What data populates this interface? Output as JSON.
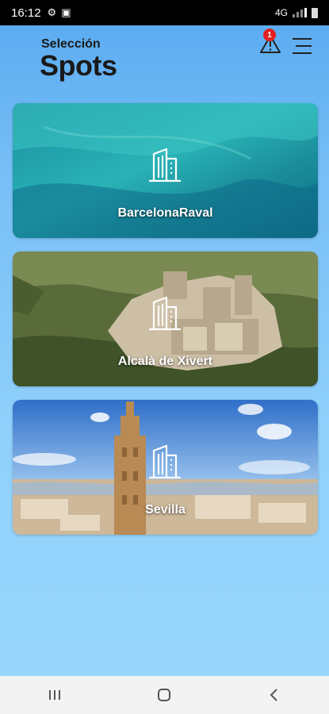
{
  "statusbar": {
    "time": "16:12",
    "network": "4G"
  },
  "header": {
    "subtitle": "Selección",
    "title": "Spots",
    "alert_count": "1"
  },
  "spots": [
    {
      "name": "BarcelonaRaval"
    },
    {
      "name": "Alcalà de Xivert"
    },
    {
      "name": "Sevilla"
    }
  ],
  "icons": {
    "alert": "warning-icon",
    "menu": "hamburger-menu-icon",
    "spot": "city-buildings-icon"
  },
  "colors": {
    "accent": "#58a9f0",
    "badge": "#e02020"
  }
}
